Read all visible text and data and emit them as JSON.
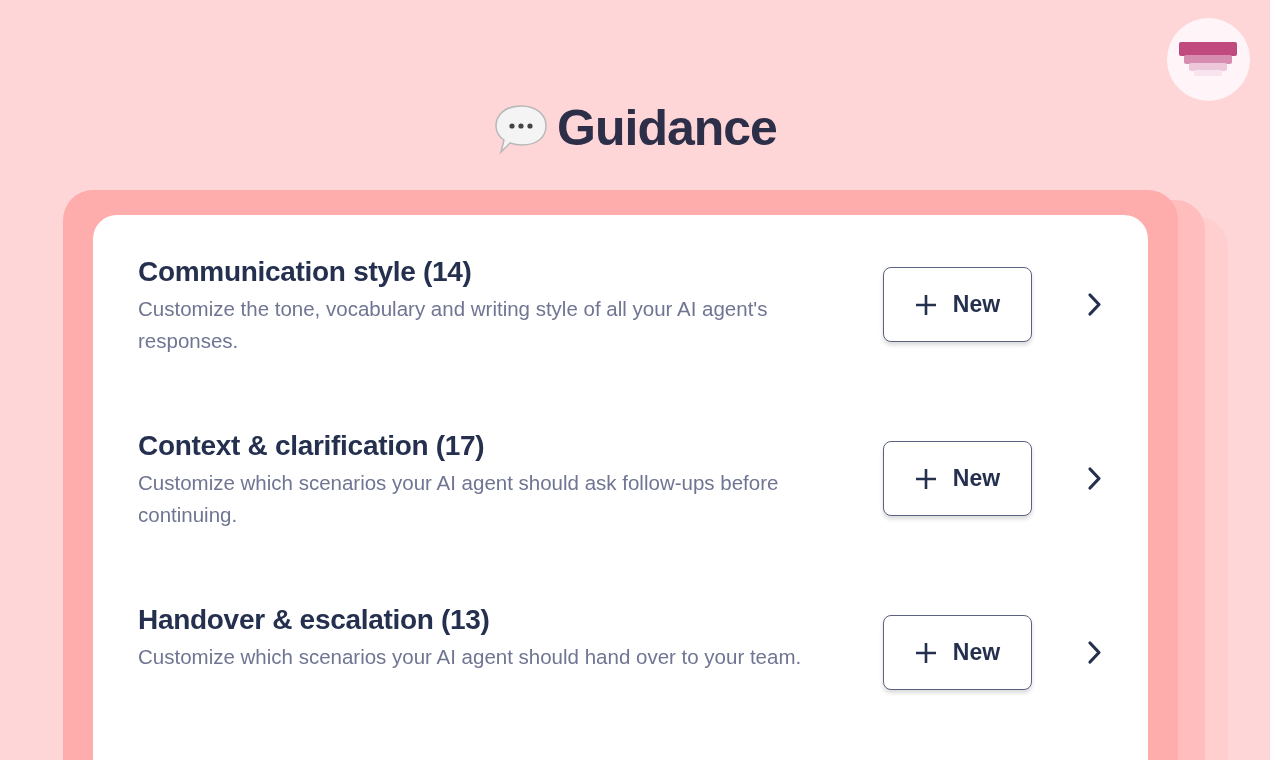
{
  "page_title": "Guidance",
  "sections": [
    {
      "title": "Communication style (14)",
      "description": "Customize the tone, vocabulary and writing style of all your AI agent's responses.",
      "button": "New"
    },
    {
      "title": "Context & clarification (17)",
      "description": "Customize which scenarios your AI agent should ask follow-ups before continuing.",
      "button": "New"
    },
    {
      "title": "Handover & escalation (13)",
      "description": "Customize which scenarios your AI agent should hand over to your team.",
      "button": "New"
    }
  ]
}
